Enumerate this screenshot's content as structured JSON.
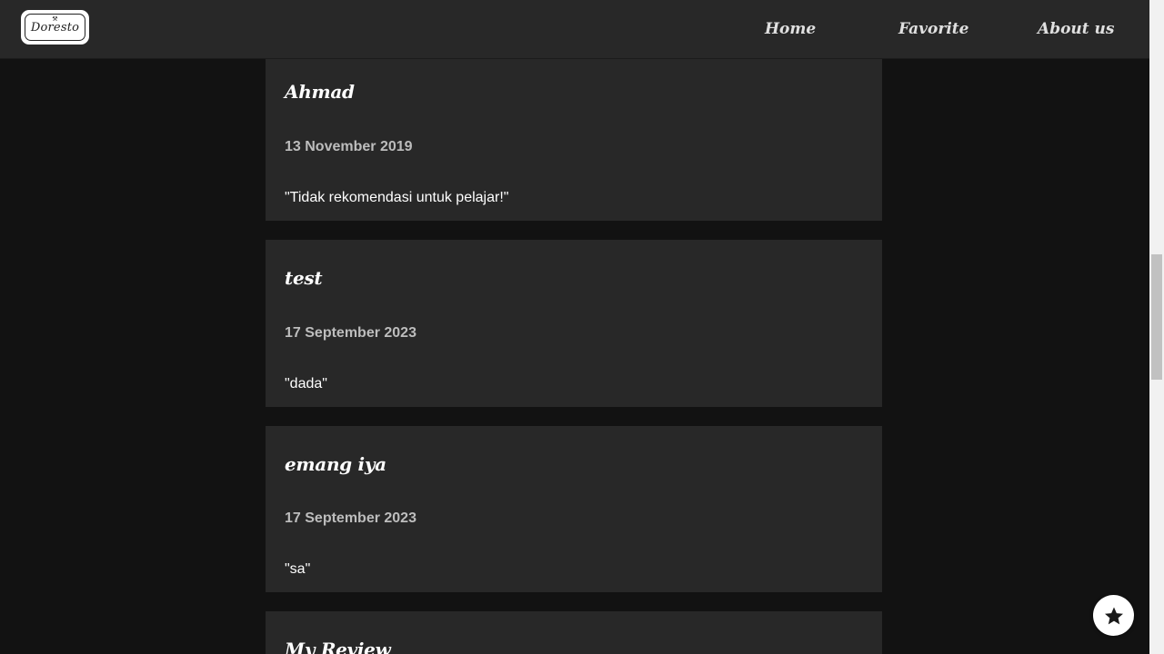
{
  "nav": {
    "logo_text": "Doresto",
    "logo_mark": "⚒",
    "links": [
      "Home",
      "Favorite",
      "About us"
    ]
  },
  "reviews": [
    {
      "name": "Ahmad",
      "date": "13 November 2019",
      "text": "\"Tidak rekomendasi untuk pelajar!\""
    },
    {
      "name": "test",
      "date": "17 September 2023",
      "text": "\"dada\""
    },
    {
      "name": "emang iya",
      "date": "17 September 2023",
      "text": "\"sa\""
    }
  ],
  "my_review": {
    "title": "My Review"
  },
  "fab": {
    "icon": "star-icon"
  },
  "colors": {
    "background": "#121212",
    "navbar": "#282828",
    "card": "#282828",
    "date_text": "#bdbdbd"
  }
}
